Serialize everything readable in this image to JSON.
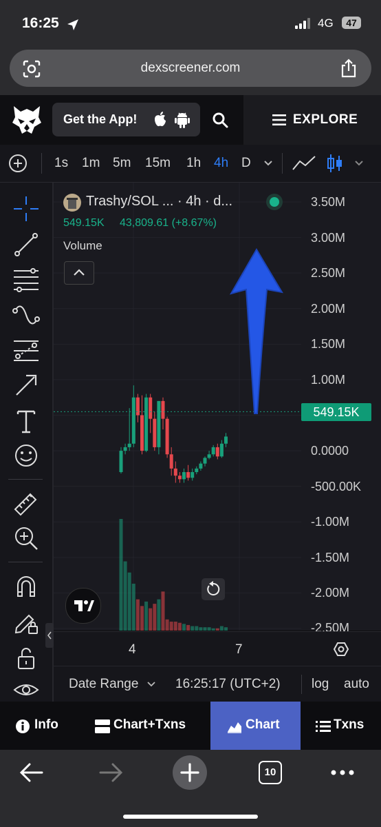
{
  "status": {
    "time": "16:25",
    "network": "4G",
    "battery": "47"
  },
  "browser": {
    "url": "dexscreener.com",
    "tab_count": "10"
  },
  "site": {
    "get_app_label": "Get the App!",
    "explore_label": "EXPLORE"
  },
  "timeframes": [
    "1s",
    "1m",
    "5m",
    "15m",
    "1h",
    "4h",
    "D"
  ],
  "active_timeframe": "4h",
  "legend": {
    "pair": "Trashy/SOL ... · 4h · d...",
    "price": "549.15K",
    "change": "43,809.61 (+8.67%)",
    "volume_label": "Volume"
  },
  "price_axis": [
    "3.50M",
    "3.00M",
    "2.50M",
    "2.00M",
    "1.50M",
    "1.00M",
    "0.0000",
    "-500.00K",
    "-1.00M",
    "-1.50M",
    "-2.00M",
    "-2.50M"
  ],
  "current_price_badge": "549.15K",
  "time_axis": [
    "4",
    "7"
  ],
  "bottom_bar": {
    "date_range": "Date Range",
    "clock": "16:25:17 (UTC+2)",
    "log": "log",
    "auto": "auto"
  },
  "site_tabs": [
    {
      "label": "Info"
    },
    {
      "label": "Chart+Txns"
    },
    {
      "label": "Chart"
    },
    {
      "label": "Txns"
    }
  ],
  "active_site_tab": "Chart",
  "colors": {
    "up": "#19a07b",
    "down": "#e5484d",
    "accent": "#2e7df7",
    "arrow": "#2457e6",
    "active_tab": "#4c62c4"
  },
  "chart_data": {
    "type": "candlestick",
    "candles": [
      {
        "o": -0.3,
        "h": 0.05,
        "l": -0.32,
        "c": 0.0
      },
      {
        "o": 0.0,
        "h": 0.1,
        "l": -0.05,
        "c": 0.05
      },
      {
        "o": 0.05,
        "h": 0.6,
        "l": 0.0,
        "c": 0.1
      },
      {
        "o": 0.1,
        "h": 0.92,
        "l": 0.05,
        "c": 0.75
      },
      {
        "o": 0.75,
        "h": 0.8,
        "l": 0.4,
        "c": 0.5
      },
      {
        "o": 0.5,
        "h": 0.78,
        "l": -0.05,
        "c": 0.0
      },
      {
        "o": 0.0,
        "h": 0.8,
        "l": -0.02,
        "c": 0.75
      },
      {
        "o": 0.75,
        "h": 0.8,
        "l": 0.25,
        "c": 0.45
      },
      {
        "o": 0.45,
        "h": 0.55,
        "l": 0.0,
        "c": 0.05
      },
      {
        "o": 0.05,
        "h": 0.7,
        "l": -0.05,
        "c": 0.7
      },
      {
        "o": 0.7,
        "h": 0.75,
        "l": 0.3,
        "c": 0.45
      },
      {
        "o": 0.45,
        "h": 0.48,
        "l": -0.1,
        "c": -0.05
      },
      {
        "o": -0.05,
        "h": 0.05,
        "l": -0.35,
        "c": -0.25
      },
      {
        "o": -0.25,
        "h": -0.15,
        "l": -0.45,
        "c": -0.35
      },
      {
        "o": -0.35,
        "h": -0.3,
        "l": -0.45,
        "c": -0.4
      },
      {
        "o": -0.4,
        "h": -0.25,
        "l": -0.45,
        "c": -0.3
      },
      {
        "o": -0.3,
        "h": -0.2,
        "l": -0.42,
        "c": -0.38
      },
      {
        "o": -0.38,
        "h": -0.25,
        "l": -0.42,
        "c": -0.3
      },
      {
        "o": -0.3,
        "h": -0.22,
        "l": -0.33,
        "c": -0.25
      },
      {
        "o": -0.25,
        "h": -0.15,
        "l": -0.28,
        "c": -0.18
      },
      {
        "o": -0.18,
        "h": -0.08,
        "l": -0.22,
        "c": -0.1
      },
      {
        "o": -0.1,
        "h": 0.0,
        "l": -0.12,
        "c": -0.05
      },
      {
        "o": -0.05,
        "h": 0.08,
        "l": -0.08,
        "c": 0.05
      },
      {
        "o": 0.05,
        "h": 0.1,
        "l": -0.12,
        "c": -0.08
      },
      {
        "o": -0.08,
        "h": 0.15,
        "l": -0.1,
        "c": 0.1
      },
      {
        "o": 0.1,
        "h": 0.25,
        "l": 0.05,
        "c": 0.2
      }
    ],
    "volume_relative": [
      1.0,
      0.62,
      0.52,
      0.42,
      0.28,
      0.22,
      0.26,
      0.2,
      0.24,
      0.28,
      0.35,
      0.1,
      0.08,
      0.08,
      0.07,
      0.06,
      0.05,
      0.04,
      0.04,
      0.03,
      0.03,
      0.03,
      0.02,
      0.02,
      0.04,
      0.03
    ],
    "ylim": [
      -2.5,
      3.5
    ],
    "y_unit": "M"
  }
}
